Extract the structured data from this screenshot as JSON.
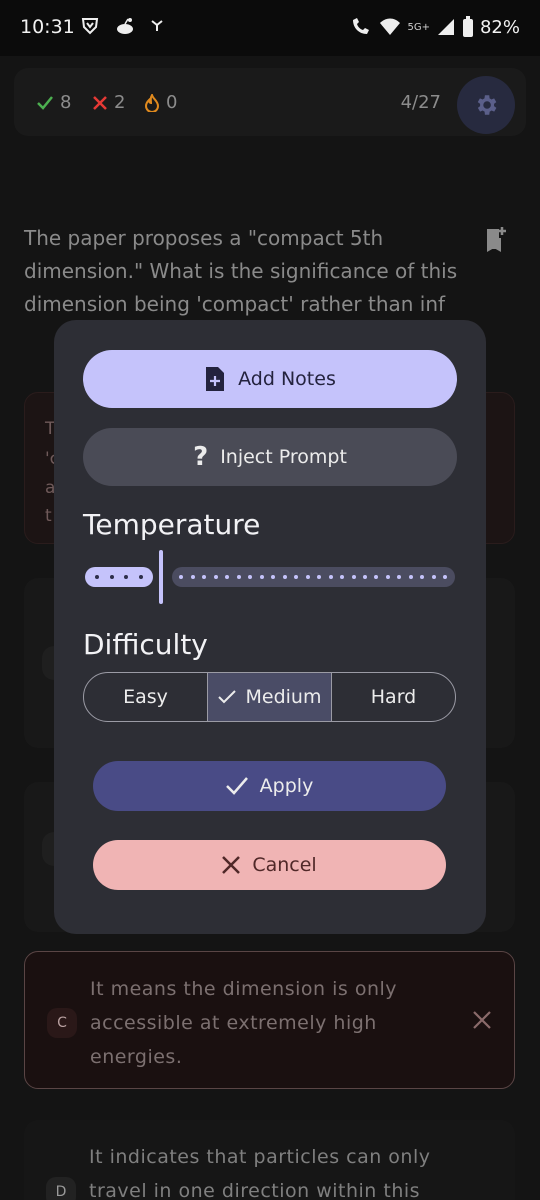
{
  "status": {
    "time": "10:31",
    "network": "5G+",
    "battery": "82%"
  },
  "score": {
    "correct": "8",
    "wrong": "2",
    "streak": "0",
    "progress": "4/27"
  },
  "question": {
    "text": "The paper proposes a \"compact 5th dimension.\" What is the significance of this dimension being 'compact' rather than inf"
  },
  "background": {
    "card_a_fragments": [
      "T",
      "'c",
      "a",
      "t"
    ],
    "option_c": {
      "letter": "C",
      "text": "It means the dimension is only accessible at extremely high energies."
    },
    "option_d": {
      "letter": "D",
      "text": "It indicates that particles can only travel in one direction within this"
    }
  },
  "modal": {
    "add_notes_label": "Add Notes",
    "inject_prompt_label": "Inject Prompt",
    "temperature_title": "Temperature",
    "temperature_value": 0.2,
    "difficulty_title": "Difficulty",
    "difficulty_options": [
      "Easy",
      "Medium",
      "Hard"
    ],
    "difficulty_selected": "Medium",
    "apply_label": "Apply",
    "cancel_label": "Cancel"
  },
  "colors": {
    "accent": "#c5c3fb",
    "apply": "#494b86",
    "cancel": "#f0b4b4",
    "correct": "#4caf50",
    "wrong": "#e53935",
    "streak": "#e08a1e"
  }
}
